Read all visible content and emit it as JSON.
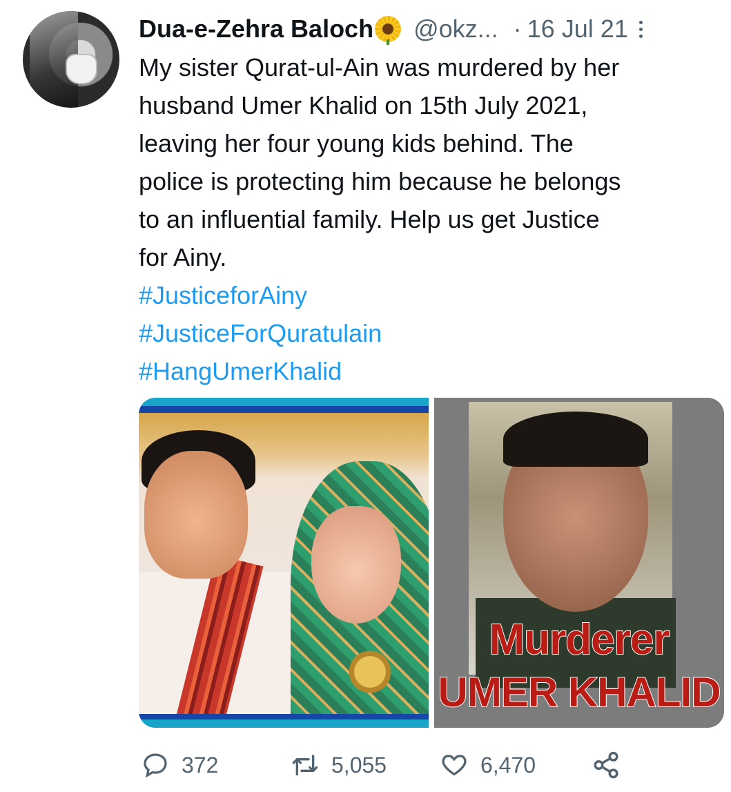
{
  "tweet": {
    "display_name": "Dua-e-Zehra Baloch",
    "name_emoji": "sunflower",
    "handle": "@okz...",
    "separator": "·",
    "date": "16 Jul 21",
    "text": "My sister Qurat-ul-Ain was murdered by her\nhusband Umer Khalid on 15th July 2021,\nleaving her four young kids behind. The\npolice is protecting him because he belongs\nto an influential family. Help us get Justice\nfor Ainy.",
    "hashtags": [
      "#JusticeforAiny",
      "#JusticeForQuratulain",
      "#HangUmerKhalid"
    ]
  },
  "media": {
    "photo2_caption_line1": "Murderer",
    "photo2_caption_line2": "UMER KHALID"
  },
  "actions": {
    "replies": "372",
    "retweets": "5,055",
    "likes": "6,470"
  },
  "icons": {
    "more": "more-vertical-icon",
    "reply": "reply-icon",
    "retweet": "retweet-icon",
    "like": "heart-icon",
    "share": "share-icon"
  },
  "colors": {
    "link": "#1d9bf0",
    "muted": "#536471",
    "text": "#0f1419"
  }
}
